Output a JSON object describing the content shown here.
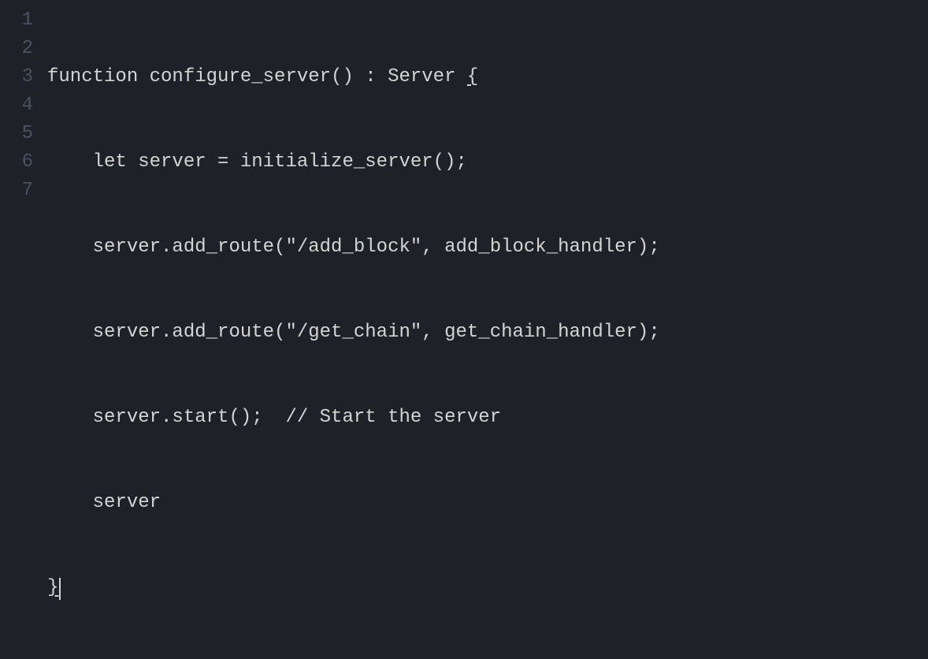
{
  "editor": {
    "lineNumbers": [
      "1",
      "2",
      "3",
      "4",
      "5",
      "6",
      "7"
    ],
    "code": {
      "line1": {
        "prefix": "function configure_server() : Server ",
        "brace": "{"
      },
      "line2": "    let server = initialize_server();",
      "line3": "    server.add_route(\"/add_block\", add_block_handler);",
      "line4": "    server.add_route(\"/get_chain\", get_chain_handler);",
      "line5": "    server.start();  // Start the server",
      "line6": "    server",
      "line7": "}"
    }
  }
}
